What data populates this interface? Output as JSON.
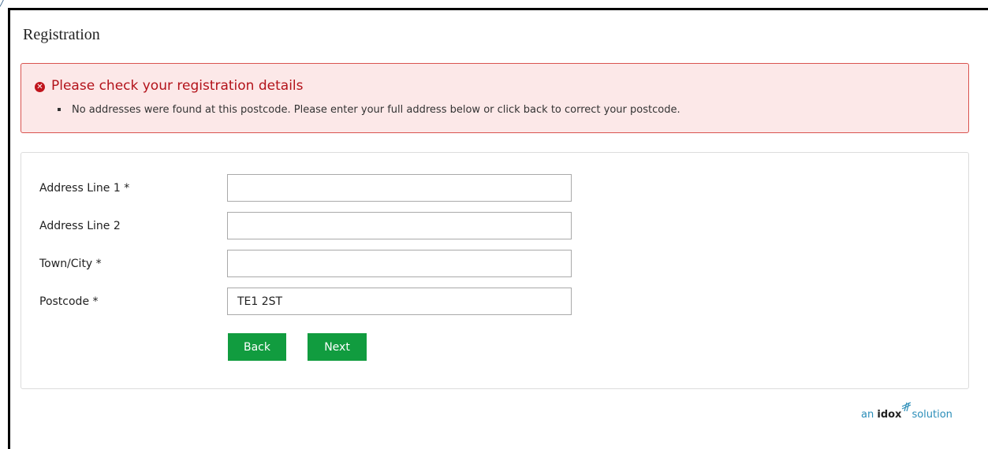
{
  "page": {
    "title": "Registration"
  },
  "error": {
    "title": "Please check your registration details",
    "messages": [
      "No addresses were found at this postcode. Please enter your full address below or click back to correct your postcode."
    ],
    "icon": "error-circle-icon"
  },
  "form": {
    "fields": [
      {
        "label": "Address Line 1 *",
        "value": ""
      },
      {
        "label": "Address Line 2",
        "value": ""
      },
      {
        "label": "Town/City *",
        "value": ""
      },
      {
        "label": "Postcode *",
        "value": "TE1 2ST"
      }
    ],
    "buttons": {
      "back_label": "Back",
      "next_label": "Next"
    }
  },
  "footer": {
    "prefix": "an",
    "brand": "idox",
    "suffix": "solution",
    "logo_icon": "idox-logo-icon"
  },
  "colors": {
    "error_text": "#b3121a",
    "error_bg": "#fce8e8",
    "button_green": "#119c3f",
    "footer_blue": "#2a8db8"
  }
}
